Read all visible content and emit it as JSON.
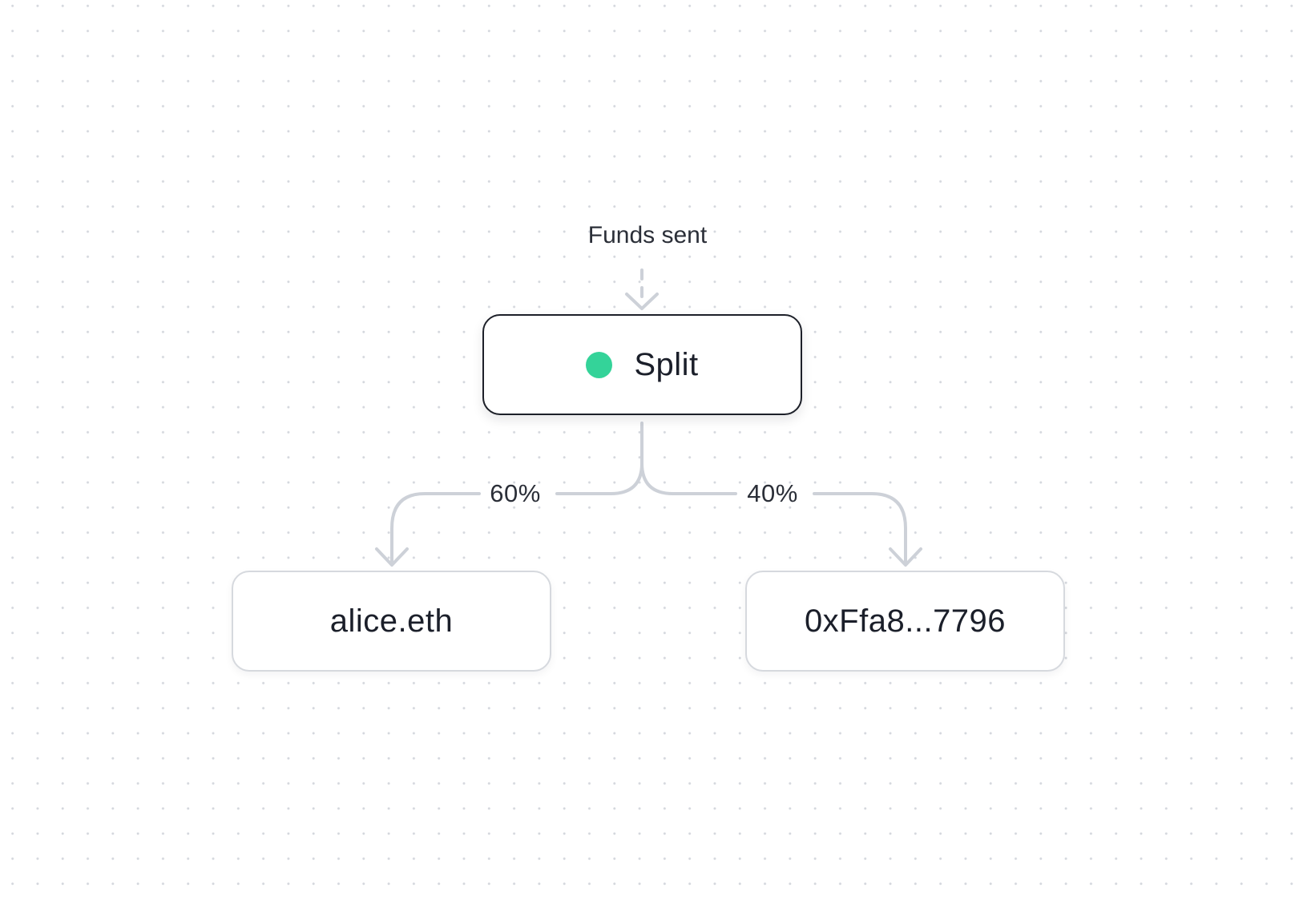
{
  "source": {
    "label": "Funds sent"
  },
  "split": {
    "label": "Split",
    "status_color": "#34d399"
  },
  "recipients": [
    {
      "label": "alice.eth",
      "share": "60%"
    },
    {
      "label": "0xFfa8...7796",
      "share": "40%"
    }
  ],
  "colors": {
    "connector": "#cdd1d8",
    "split_border": "#1d2029",
    "recipient_border": "#d6d9de"
  }
}
